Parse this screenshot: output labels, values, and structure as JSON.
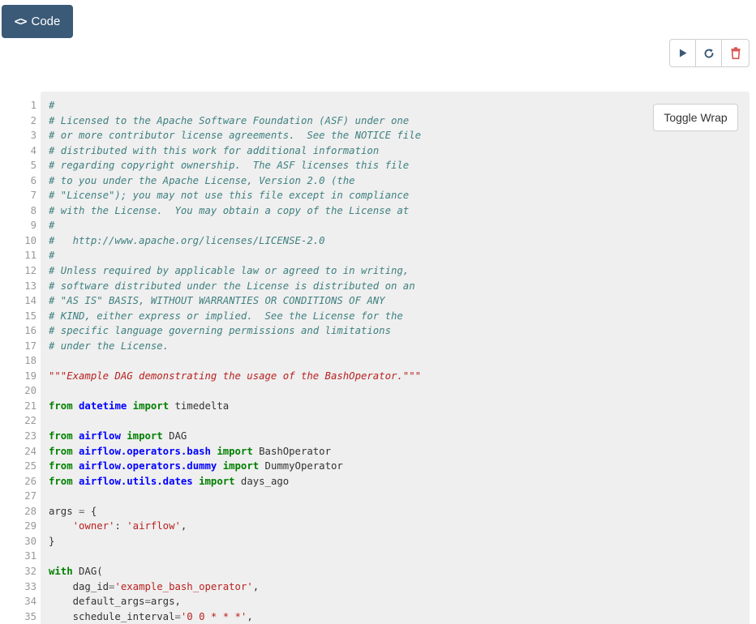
{
  "header": {
    "code_tab": {
      "icon": "code-brackets-icon",
      "label": "Code"
    }
  },
  "toolbar": {
    "buttons": [
      {
        "name": "run-button",
        "icon": "play-icon"
      },
      {
        "name": "refresh-button",
        "icon": "refresh-icon"
      },
      {
        "name": "delete-button",
        "icon": "trash-icon"
      }
    ]
  },
  "code_view": {
    "toggle_wrap_label": "Toggle Wrap",
    "colors": {
      "comment": "#408080",
      "string": "#ba2121",
      "keyword": "#008000",
      "module": "#0000ff",
      "background": "#efefef"
    },
    "lines": [
      [
        [
          "c",
          "#"
        ]
      ],
      [
        [
          "c",
          "# Licensed to the Apache Software Foundation (ASF) under one"
        ]
      ],
      [
        [
          "c",
          "# or more contributor license agreements.  See the NOTICE file"
        ]
      ],
      [
        [
          "c",
          "# distributed with this work for additional information"
        ]
      ],
      [
        [
          "c",
          "# regarding copyright ownership.  The ASF licenses this file"
        ]
      ],
      [
        [
          "c",
          "# to you under the Apache License, Version 2.0 (the"
        ]
      ],
      [
        [
          "c",
          "# \"License\"); you may not use this file except in compliance"
        ]
      ],
      [
        [
          "c",
          "# with the License.  You may obtain a copy of the License at"
        ]
      ],
      [
        [
          "c",
          "#"
        ]
      ],
      [
        [
          "c",
          "#   http://www.apache.org/licenses/LICENSE-2.0"
        ]
      ],
      [
        [
          "c",
          "#"
        ]
      ],
      [
        [
          "c",
          "# Unless required by applicable law or agreed to in writing,"
        ]
      ],
      [
        [
          "c",
          "# software distributed under the License is distributed on an"
        ]
      ],
      [
        [
          "c",
          "# \"AS IS\" BASIS, WITHOUT WARRANTIES OR CONDITIONS OF ANY"
        ]
      ],
      [
        [
          "c",
          "# KIND, either express or implied.  See the License for the"
        ]
      ],
      [
        [
          "c",
          "# specific language governing permissions and limitations"
        ]
      ],
      [
        [
          "c",
          "# under the License."
        ]
      ],
      [],
      [
        [
          "sd",
          "\"\"\"Example DAG demonstrating the usage of the BashOperator.\"\"\""
        ]
      ],
      [],
      [
        [
          "k",
          "from"
        ],
        [
          "n",
          " "
        ],
        [
          "nn",
          "datetime"
        ],
        [
          "n",
          " "
        ],
        [
          "k",
          "import"
        ],
        [
          "n",
          " timedelta"
        ]
      ],
      [],
      [
        [
          "k",
          "from"
        ],
        [
          "n",
          " "
        ],
        [
          "nn",
          "airflow"
        ],
        [
          "n",
          " "
        ],
        [
          "k",
          "import"
        ],
        [
          "n",
          " DAG"
        ]
      ],
      [
        [
          "k",
          "from"
        ],
        [
          "n",
          " "
        ],
        [
          "nn",
          "airflow.operators.bash"
        ],
        [
          "n",
          " "
        ],
        [
          "k",
          "import"
        ],
        [
          "n",
          " BashOperator"
        ]
      ],
      [
        [
          "k",
          "from"
        ],
        [
          "n",
          " "
        ],
        [
          "nn",
          "airflow.operators.dummy"
        ],
        [
          "n",
          " "
        ],
        [
          "k",
          "import"
        ],
        [
          "n",
          " DummyOperator"
        ]
      ],
      [
        [
          "k",
          "from"
        ],
        [
          "n",
          " "
        ],
        [
          "nn",
          "airflow.utils.dates"
        ],
        [
          "n",
          " "
        ],
        [
          "k",
          "import"
        ],
        [
          "n",
          " days_ago"
        ]
      ],
      [],
      [
        [
          "n",
          "args "
        ],
        [
          "o",
          "="
        ],
        [
          "n",
          " {"
        ]
      ],
      [
        [
          "n",
          "    "
        ],
        [
          "s",
          "'owner'"
        ],
        [
          "n",
          ": "
        ],
        [
          "s",
          "'airflow'"
        ],
        [
          "n",
          ","
        ]
      ],
      [
        [
          "n",
          "}"
        ]
      ],
      [],
      [
        [
          "k",
          "with"
        ],
        [
          "n",
          " DAG("
        ]
      ],
      [
        [
          "n",
          "    dag_id"
        ],
        [
          "o",
          "="
        ],
        [
          "s",
          "'example_bash_operator'"
        ],
        [
          "n",
          ","
        ]
      ],
      [
        [
          "n",
          "    default_args"
        ],
        [
          "o",
          "="
        ],
        [
          "n",
          "args,"
        ]
      ],
      [
        [
          "n",
          "    schedule_interval"
        ],
        [
          "o",
          "="
        ],
        [
          "s",
          "'0 0 * * *'"
        ],
        [
          "n",
          ","
        ]
      ]
    ]
  }
}
